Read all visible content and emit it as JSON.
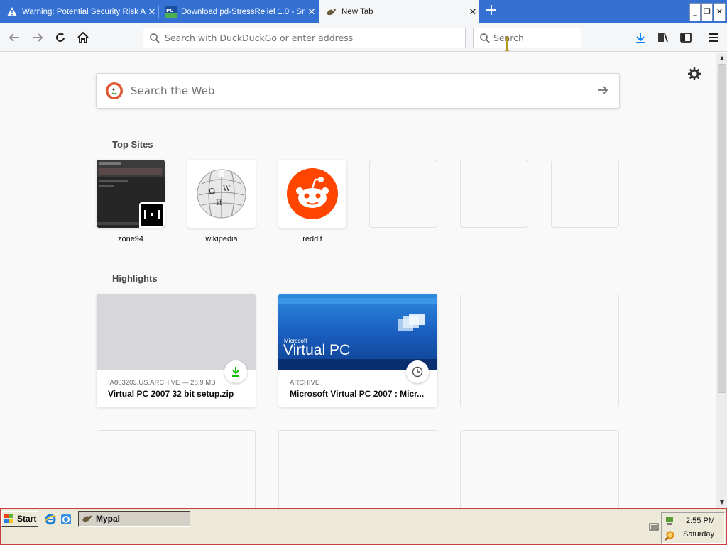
{
  "tabs": [
    {
      "title": "Warning: Potential Security Risk A",
      "icon": "warning-icon",
      "active": false
    },
    {
      "title": "Download pd-StressRelief 1.0 - Sn",
      "icon": "pcwin-icon",
      "active": false
    },
    {
      "title": "New Tab",
      "icon": "mypal-icon",
      "active": true
    }
  ],
  "navbar": {
    "url_placeholder": "Search with DuckDuckGo or enter address",
    "search_placeholder": "Search"
  },
  "newtab": {
    "web_search_placeholder": "Search the Web",
    "top_sites_heading": "Top Sites",
    "top_sites": [
      {
        "label": "zone94"
      },
      {
        "label": "wikipedia"
      },
      {
        "label": "reddit"
      },
      {
        "label": ""
      },
      {
        "label": ""
      },
      {
        "label": ""
      }
    ],
    "highlights_heading": "Highlights",
    "highlights": [
      {
        "meta": "IA803203.US.ARCHIVE — 28.9 MB",
        "title": "Virtual PC 2007 32 bit setup.zip",
        "badge": "download-icon"
      },
      {
        "meta": "ARCHIVE",
        "title": "Microsoft Virtual PC 2007 : Micr...",
        "badge": "clock-icon",
        "thumb_text_small": "Microsoft",
        "thumb_text_big": "Virtual PC"
      }
    ]
  },
  "taskbar": {
    "start_label": "Start",
    "task_label": "Mypal",
    "clock_time": "2:55 PM",
    "clock_day": "Saturday"
  },
  "colors": {
    "tabstrip": "#3471d3",
    "toolbar": "#f5f6f7",
    "page_bg": "#f9f9fa",
    "download_accent": "#0a84ff",
    "reddit_orange": "#ff4500"
  }
}
